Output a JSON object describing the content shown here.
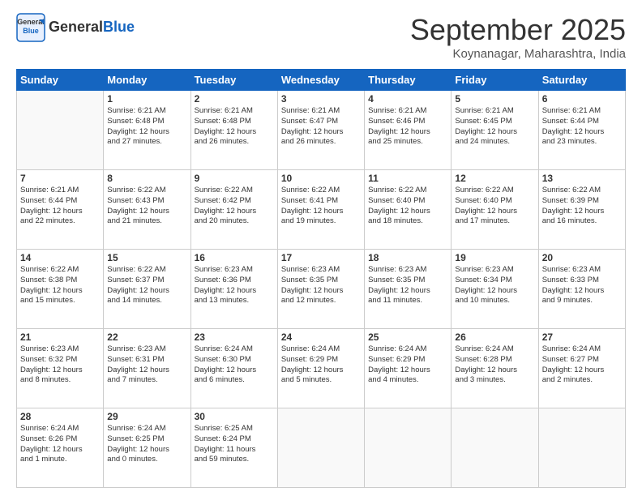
{
  "header": {
    "logo_general": "General",
    "logo_blue": "Blue",
    "month_title": "September 2025",
    "location": "Koynanagar, Maharashtra, India"
  },
  "days_of_week": [
    "Sunday",
    "Monday",
    "Tuesday",
    "Wednesday",
    "Thursday",
    "Friday",
    "Saturday"
  ],
  "weeks": [
    [
      {
        "day": "",
        "info": ""
      },
      {
        "day": "1",
        "info": "Sunrise: 6:21 AM\nSunset: 6:48 PM\nDaylight: 12 hours\nand 27 minutes."
      },
      {
        "day": "2",
        "info": "Sunrise: 6:21 AM\nSunset: 6:48 PM\nDaylight: 12 hours\nand 26 minutes."
      },
      {
        "day": "3",
        "info": "Sunrise: 6:21 AM\nSunset: 6:47 PM\nDaylight: 12 hours\nand 26 minutes."
      },
      {
        "day": "4",
        "info": "Sunrise: 6:21 AM\nSunset: 6:46 PM\nDaylight: 12 hours\nand 25 minutes."
      },
      {
        "day": "5",
        "info": "Sunrise: 6:21 AM\nSunset: 6:45 PM\nDaylight: 12 hours\nand 24 minutes."
      },
      {
        "day": "6",
        "info": "Sunrise: 6:21 AM\nSunset: 6:44 PM\nDaylight: 12 hours\nand 23 minutes."
      }
    ],
    [
      {
        "day": "7",
        "info": "Sunrise: 6:21 AM\nSunset: 6:44 PM\nDaylight: 12 hours\nand 22 minutes."
      },
      {
        "day": "8",
        "info": "Sunrise: 6:22 AM\nSunset: 6:43 PM\nDaylight: 12 hours\nand 21 minutes."
      },
      {
        "day": "9",
        "info": "Sunrise: 6:22 AM\nSunset: 6:42 PM\nDaylight: 12 hours\nand 20 minutes."
      },
      {
        "day": "10",
        "info": "Sunrise: 6:22 AM\nSunset: 6:41 PM\nDaylight: 12 hours\nand 19 minutes."
      },
      {
        "day": "11",
        "info": "Sunrise: 6:22 AM\nSunset: 6:40 PM\nDaylight: 12 hours\nand 18 minutes."
      },
      {
        "day": "12",
        "info": "Sunrise: 6:22 AM\nSunset: 6:40 PM\nDaylight: 12 hours\nand 17 minutes."
      },
      {
        "day": "13",
        "info": "Sunrise: 6:22 AM\nSunset: 6:39 PM\nDaylight: 12 hours\nand 16 minutes."
      }
    ],
    [
      {
        "day": "14",
        "info": "Sunrise: 6:22 AM\nSunset: 6:38 PM\nDaylight: 12 hours\nand 15 minutes."
      },
      {
        "day": "15",
        "info": "Sunrise: 6:22 AM\nSunset: 6:37 PM\nDaylight: 12 hours\nand 14 minutes."
      },
      {
        "day": "16",
        "info": "Sunrise: 6:23 AM\nSunset: 6:36 PM\nDaylight: 12 hours\nand 13 minutes."
      },
      {
        "day": "17",
        "info": "Sunrise: 6:23 AM\nSunset: 6:35 PM\nDaylight: 12 hours\nand 12 minutes."
      },
      {
        "day": "18",
        "info": "Sunrise: 6:23 AM\nSunset: 6:35 PM\nDaylight: 12 hours\nand 11 minutes."
      },
      {
        "day": "19",
        "info": "Sunrise: 6:23 AM\nSunset: 6:34 PM\nDaylight: 12 hours\nand 10 minutes."
      },
      {
        "day": "20",
        "info": "Sunrise: 6:23 AM\nSunset: 6:33 PM\nDaylight: 12 hours\nand 9 minutes."
      }
    ],
    [
      {
        "day": "21",
        "info": "Sunrise: 6:23 AM\nSunset: 6:32 PM\nDaylight: 12 hours\nand 8 minutes."
      },
      {
        "day": "22",
        "info": "Sunrise: 6:23 AM\nSunset: 6:31 PM\nDaylight: 12 hours\nand 7 minutes."
      },
      {
        "day": "23",
        "info": "Sunrise: 6:24 AM\nSunset: 6:30 PM\nDaylight: 12 hours\nand 6 minutes."
      },
      {
        "day": "24",
        "info": "Sunrise: 6:24 AM\nSunset: 6:29 PM\nDaylight: 12 hours\nand 5 minutes."
      },
      {
        "day": "25",
        "info": "Sunrise: 6:24 AM\nSunset: 6:29 PM\nDaylight: 12 hours\nand 4 minutes."
      },
      {
        "day": "26",
        "info": "Sunrise: 6:24 AM\nSunset: 6:28 PM\nDaylight: 12 hours\nand 3 minutes."
      },
      {
        "day": "27",
        "info": "Sunrise: 6:24 AM\nSunset: 6:27 PM\nDaylight: 12 hours\nand 2 minutes."
      }
    ],
    [
      {
        "day": "28",
        "info": "Sunrise: 6:24 AM\nSunset: 6:26 PM\nDaylight: 12 hours\nand 1 minute."
      },
      {
        "day": "29",
        "info": "Sunrise: 6:24 AM\nSunset: 6:25 PM\nDaylight: 12 hours\nand 0 minutes."
      },
      {
        "day": "30",
        "info": "Sunrise: 6:25 AM\nSunset: 6:24 PM\nDaylight: 11 hours\nand 59 minutes."
      },
      {
        "day": "",
        "info": ""
      },
      {
        "day": "",
        "info": ""
      },
      {
        "day": "",
        "info": ""
      },
      {
        "day": "",
        "info": ""
      }
    ]
  ]
}
